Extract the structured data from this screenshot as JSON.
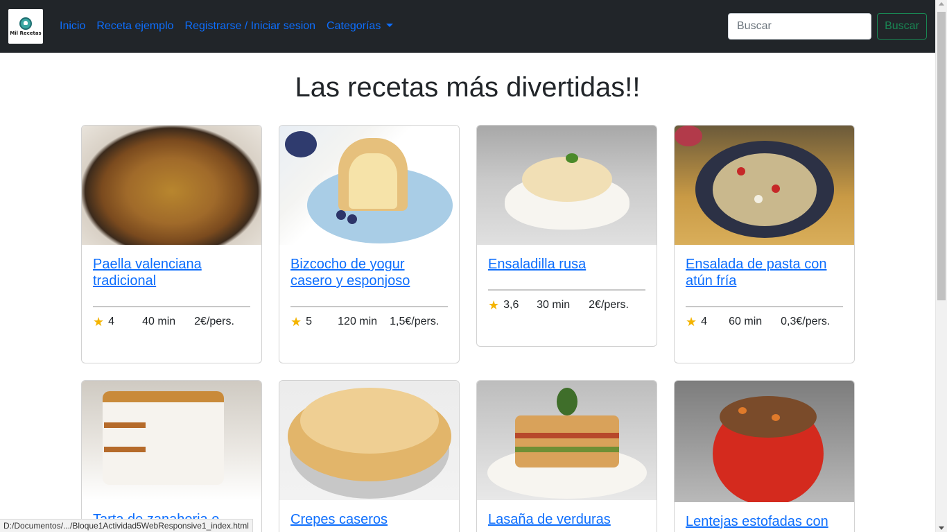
{
  "navbar": {
    "logo_text": "Mil Recetas",
    "links": [
      "Inicio",
      "Receta ejemplo",
      "Registrarse / Iniciar sesion",
      "Categorías"
    ],
    "search_placeholder": "Buscar",
    "search_button": "Buscar"
  },
  "title": "Las recetas más divertidas!!",
  "recipes": [
    {
      "name": "Paella valenciana tradicional",
      "rating": "4",
      "time": "40 min",
      "price": "2€/pers."
    },
    {
      "name": "Bizcocho de yogur casero y esponjoso",
      "rating": "5",
      "time": "120 min",
      "price": "1,5€/pers."
    },
    {
      "name": "Ensaladilla rusa",
      "rating": "3,6",
      "time": "30 min",
      "price": "2€/pers."
    },
    {
      "name": "Ensalada de pasta con atún fría",
      "rating": "4",
      "time": "60 min",
      "price": "0,3€/pers."
    },
    {
      "name": "Tarta de zanahoria o"
    },
    {
      "name": "Crepes caseros"
    },
    {
      "name": "Lasaña de verduras"
    },
    {
      "name": "Lentejas estofadas con"
    }
  ],
  "status_bar": "D:/Documentos/.../Bloque1Actividad5WebResponsive1_index.html",
  "colors": {
    "navbar_bg": "#212529",
    "link": "#0d6efd",
    "button_outline": "#198754",
    "star": "#f4b400"
  }
}
